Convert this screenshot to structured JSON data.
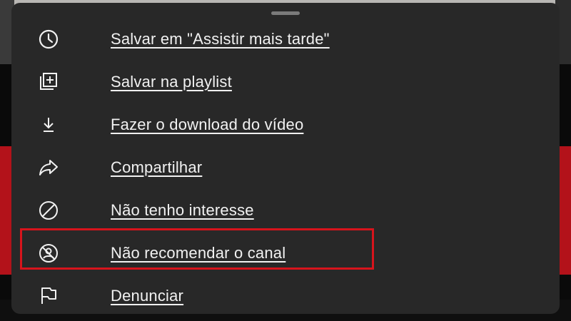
{
  "menu": {
    "items": [
      {
        "label": "Salvar em \"Assistir mais tarde\"",
        "icon": "clock-icon"
      },
      {
        "label": "Salvar na playlist",
        "icon": "playlist-add-icon"
      },
      {
        "label": "Fazer o download do vídeo",
        "icon": "download-icon"
      },
      {
        "label": "Compartilhar",
        "icon": "share-icon"
      },
      {
        "label": "Não tenho interesse",
        "icon": "not-interested-icon"
      },
      {
        "label": "Não recomendar o canal",
        "icon": "dont-recommend-channel-icon",
        "highlighted": true
      },
      {
        "label": "Denunciar",
        "icon": "flag-icon"
      }
    ]
  },
  "colors": {
    "sheet_background": "#282828",
    "text": "#f1f1f1",
    "highlight_border": "#d7141c"
  }
}
